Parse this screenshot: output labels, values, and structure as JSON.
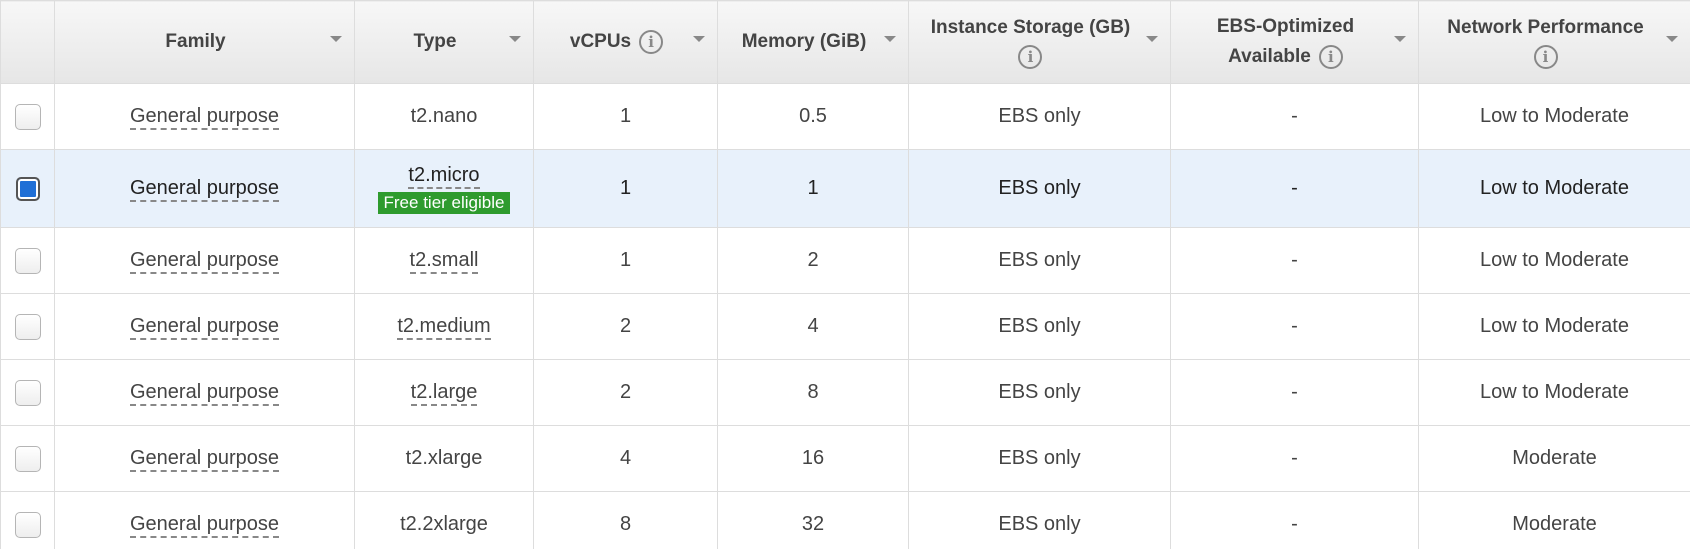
{
  "columns": {
    "family": "Family",
    "type": "Type",
    "vcpus": "vCPUs",
    "memory": "Memory (GiB)",
    "storage": "Instance Storage (GB)",
    "ebs_line1": "EBS-Optimized",
    "ebs_line2": "Available",
    "network": "Network Performance",
    "info_glyph": "i"
  },
  "badge": "Free tier eligible",
  "accent_color": "#1f6fd6",
  "badge_color": "#2e9b2e",
  "rows": [
    {
      "checked": false,
      "family": "General purpose",
      "type": "t2.nano",
      "vcpus": "1",
      "memory": "0.5",
      "storage": "EBS only",
      "ebs": "-",
      "network": "Low to Moderate"
    },
    {
      "checked": true,
      "family": "General purpose",
      "type": "t2.micro",
      "vcpus": "1",
      "memory": "1",
      "storage": "EBS only",
      "ebs": "-",
      "network": "Low to Moderate"
    },
    {
      "checked": false,
      "family": "General purpose",
      "type": "t2.small",
      "vcpus": "1",
      "memory": "2",
      "storage": "EBS only",
      "ebs": "-",
      "network": "Low to Moderate"
    },
    {
      "checked": false,
      "family": "General purpose",
      "type": "t2.medium",
      "vcpus": "2",
      "memory": "4",
      "storage": "EBS only",
      "ebs": "-",
      "network": "Low to Moderate"
    },
    {
      "checked": false,
      "family": "General purpose",
      "type": "t2.large",
      "vcpus": "2",
      "memory": "8",
      "storage": "EBS only",
      "ebs": "-",
      "network": "Low to Moderate"
    },
    {
      "checked": false,
      "family": "General purpose",
      "type": "t2.xlarge",
      "vcpus": "4",
      "memory": "16",
      "storage": "EBS only",
      "ebs": "-",
      "network": "Moderate"
    },
    {
      "checked": false,
      "family": "General purpose",
      "type": "t2.2xlarge",
      "vcpus": "8",
      "memory": "32",
      "storage": "EBS only",
      "ebs": "-",
      "network": "Moderate"
    }
  ]
}
